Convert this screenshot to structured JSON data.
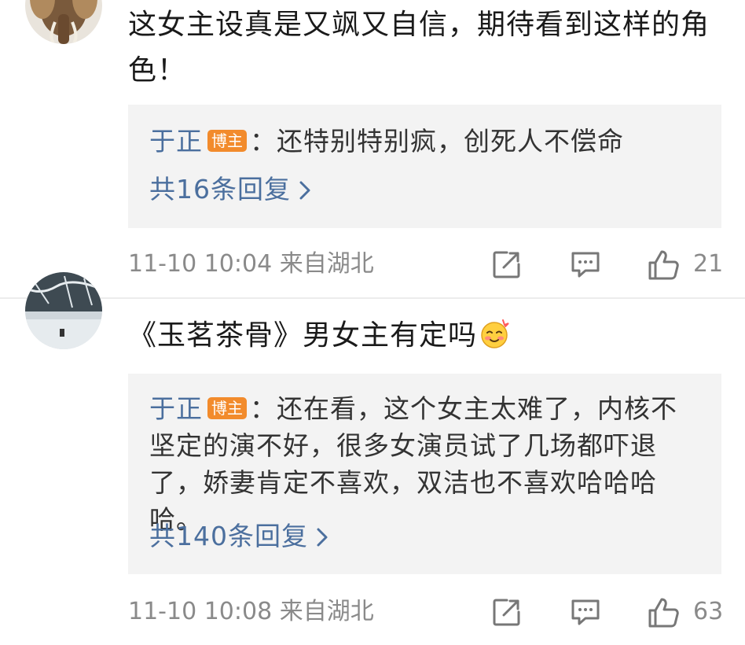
{
  "comments": [
    {
      "text": "这女主设真是又飒又自信，期待看到这样的角色！",
      "reply": {
        "author": "于正",
        "badge": "博主",
        "text": "：还特别特别疯，创死人不偿命",
        "more": "共16条回复"
      },
      "time": "11-10 10:04",
      "location": "来自湖北",
      "likes": "21"
    },
    {
      "text": "《玉茗茶骨》男女主有定吗",
      "emoji": "blushing-face-emoji",
      "reply": {
        "author": "于正",
        "badge": "博主",
        "text": "：还在看，这个女主太难了，内核不坚定的演不好，很多女演员试了几场都吓退了，娇妻肯定不喜欢，双洁也不喜欢哈哈哈哈。",
        "more": "共140条回复"
      },
      "time": "11-10 10:08",
      "location": "来自湖北",
      "likes": "63"
    }
  ],
  "icons": {
    "share": "share-icon",
    "comment": "comment-icon",
    "like": "thumbs-up-icon",
    "more": "chevron-right-icon"
  },
  "colors": {
    "link": "#4b6f9e",
    "badge": "#f28b2c",
    "reply_bg": "#f3f3f3",
    "meta": "#8a8a8a"
  }
}
